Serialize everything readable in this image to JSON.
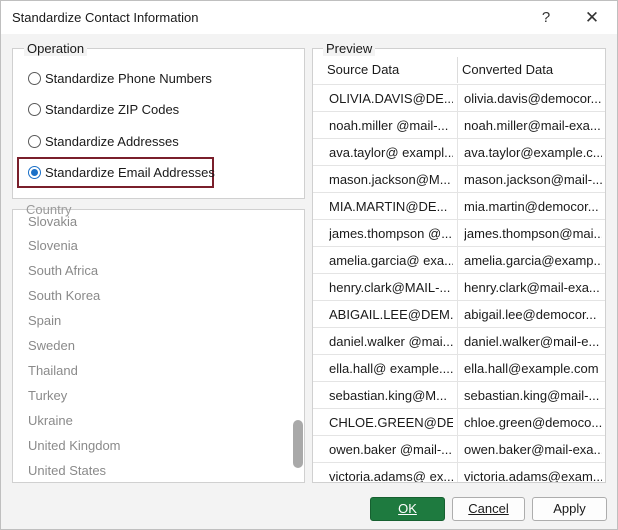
{
  "window": {
    "title": "Standardize Contact Information",
    "help_label": "?",
    "close_label": "✕"
  },
  "operation": {
    "label": "Operation",
    "options": [
      {
        "label": "Standardize Phone Numbers",
        "checked": false
      },
      {
        "label": "Standardize ZIP Codes",
        "checked": false
      },
      {
        "label": "Standardize Addresses",
        "checked": false
      },
      {
        "label": "Standardize Email Addresses",
        "checked": true
      }
    ]
  },
  "country": {
    "label": "Country",
    "items": [
      "Slovakia",
      "Slovenia",
      "South Africa",
      "South Korea",
      "Spain",
      "Sweden",
      "Thailand",
      "Turkey",
      "Ukraine",
      "United Kingdom",
      "United States"
    ]
  },
  "preview": {
    "label": "Preview",
    "columns": [
      "Source Data",
      "Converted Data"
    ],
    "rows": [
      [
        "OLIVIA.DAVIS@DE...",
        "olivia.davis@democor..."
      ],
      [
        "noah.miller @mail-...",
        "noah.miller@mail-exa..."
      ],
      [
        "ava.taylor@ exampl...",
        "ava.taylor@example.c..."
      ],
      [
        "mason.jackson@M...",
        "mason.jackson@mail-..."
      ],
      [
        "MIA.MARTIN@DE...",
        "mia.martin@democor..."
      ],
      [
        "james.thompson @...",
        "james.thompson@mai..."
      ],
      [
        "amelia.garcia@ exa...",
        "amelia.garcia@examp..."
      ],
      [
        "henry.clark@MAIL-...",
        "henry.clark@mail-exa..."
      ],
      [
        "ABIGAIL.LEE@DEM...",
        "abigail.lee@democor..."
      ],
      [
        "daniel.walker @mai...",
        "daniel.walker@mail-e..."
      ],
      [
        "ella.hall@ example....",
        "ella.hall@example.com"
      ],
      [
        "sebastian.king@M...",
        "sebastian.king@mail-..."
      ],
      [
        "CHLOE.GREEN@DE...",
        "chloe.green@democo..."
      ],
      [
        "owen.baker @mail-...",
        "owen.baker@mail-exa..."
      ],
      [
        "victoria.adams@ ex...",
        "victoria.adams@exam..."
      ]
    ]
  },
  "buttons": {
    "ok_label": "OK",
    "cancel_label": "Cancel",
    "apply_label": "Apply"
  },
  "colors": {
    "ok_button": "#1e7a3f",
    "radio_checked": "#1a6fc7",
    "highlight_border": "#7a1f2b"
  }
}
